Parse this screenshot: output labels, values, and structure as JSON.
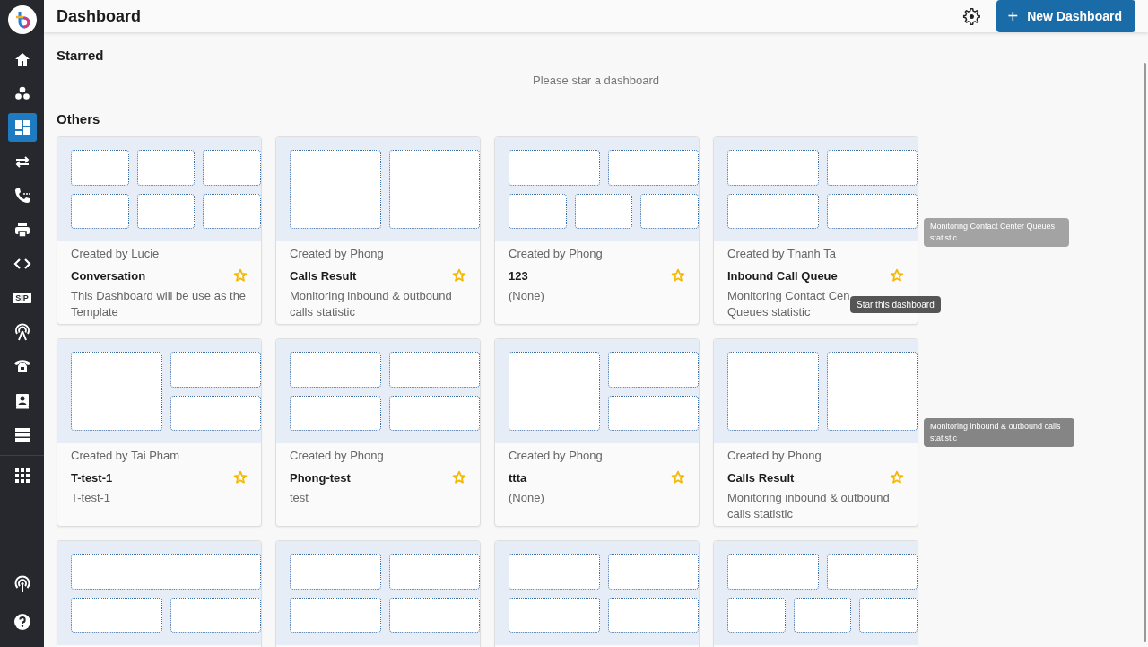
{
  "sidebar": {
    "items": [
      {
        "kind": "home",
        "selected": false
      },
      {
        "kind": "nodes",
        "selected": false
      },
      {
        "kind": "dashboard",
        "selected": true
      },
      {
        "kind": "transfer",
        "selected": false
      },
      {
        "kind": "call",
        "selected": false
      },
      {
        "kind": "printer",
        "selected": false
      },
      {
        "kind": "code",
        "selected": false
      },
      {
        "kind": "sip",
        "label": "SIP",
        "selected": false
      },
      {
        "kind": "antenna",
        "selected": false
      },
      {
        "kind": "telephone",
        "selected": false
      },
      {
        "kind": "contact",
        "selected": false
      },
      {
        "kind": "server",
        "selected": false
      },
      {
        "kind": "apps",
        "selected": false
      }
    ],
    "bottom_items": [
      {
        "kind": "broadcast",
        "selected": false
      },
      {
        "kind": "help",
        "selected": false
      }
    ]
  },
  "header": {
    "title": "Dashboard",
    "new_button": "New Dashboard",
    "plus": "+"
  },
  "starred": {
    "heading": "Starred",
    "empty_text": "Please star a dashboard"
  },
  "others": {
    "heading": "Others",
    "cards": [
      {
        "kind": "sixgrid",
        "author": "Created by Lucie",
        "name": "Conversation",
        "starred": false,
        "description": "This Dashboard will be use as the Template"
      },
      {
        "kind": "pair",
        "author": "Created by Phong",
        "name": "Calls Result",
        "starred": false,
        "description": "Monitoring inbound & outbound calls statistic"
      },
      {
        "kind": "fivegrid",
        "author": "Created by Phong",
        "name": "123",
        "starred": false,
        "description": "(None)"
      },
      {
        "kind": "quad",
        "author": "Created by Thanh Ta",
        "name": "Inbound Call Queue",
        "starred": false,
        "description": "Monitoring Contact Cen\nQueues statistic",
        "tooltip": "Star this dashboard"
      },
      {
        "kind": "tallleft",
        "author": "Created by Tai Pham",
        "name": "T-test-1",
        "starred": false,
        "description": "T-test-1"
      },
      {
        "kind": "quad",
        "author": "Created by Phong",
        "name": "Phong-test",
        "starred": false,
        "description": "test"
      },
      {
        "kind": "tallleft",
        "author": "Created by Phong",
        "name": "ttta",
        "starred": false,
        "description": "(None)"
      },
      {
        "kind": "pair",
        "author": "Created by Phong",
        "name": "Calls Result",
        "starred": false,
        "description": "Monitoring inbound & outbound calls statistic"
      },
      {
        "kind": "widetop"
      },
      {
        "kind": "quad"
      },
      {
        "kind": "quad"
      },
      {
        "kind": "fivegrid"
      }
    ]
  },
  "floating_tooltips": [
    {
      "text": "Monitoring Contact Center Queues statistic"
    },
    {
      "text": "Monitoring inbound & outbound calls statistic"
    }
  ]
}
